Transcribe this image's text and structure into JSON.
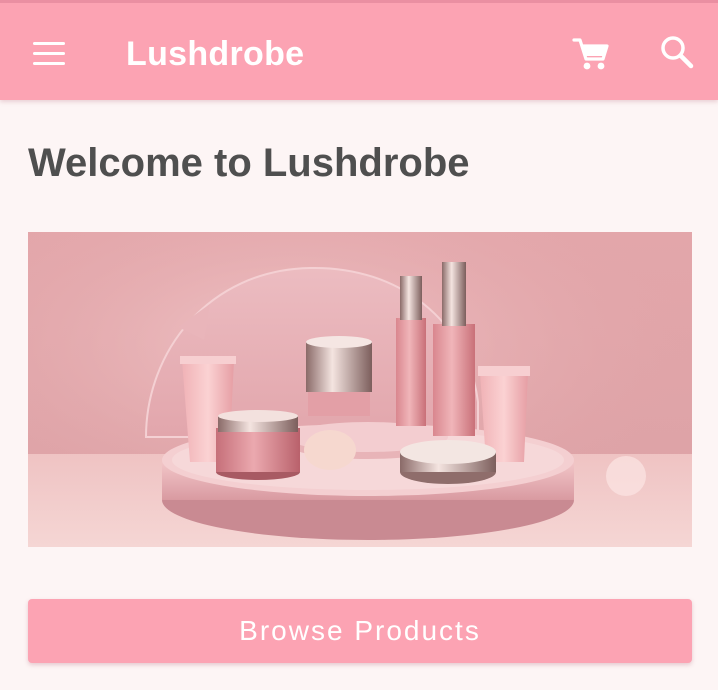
{
  "appbar": {
    "title": "Lushdrobe",
    "menu_icon": "menu-icon",
    "cart_icon": "cart-icon",
    "search_icon": "search-icon",
    "background_color": "#fca3b3"
  },
  "main": {
    "welcome_text": "Welcome to Lushdrobe",
    "hero_image_alt": "",
    "browse_button_label": "Browse Products",
    "accent_color": "#fca3b3"
  }
}
